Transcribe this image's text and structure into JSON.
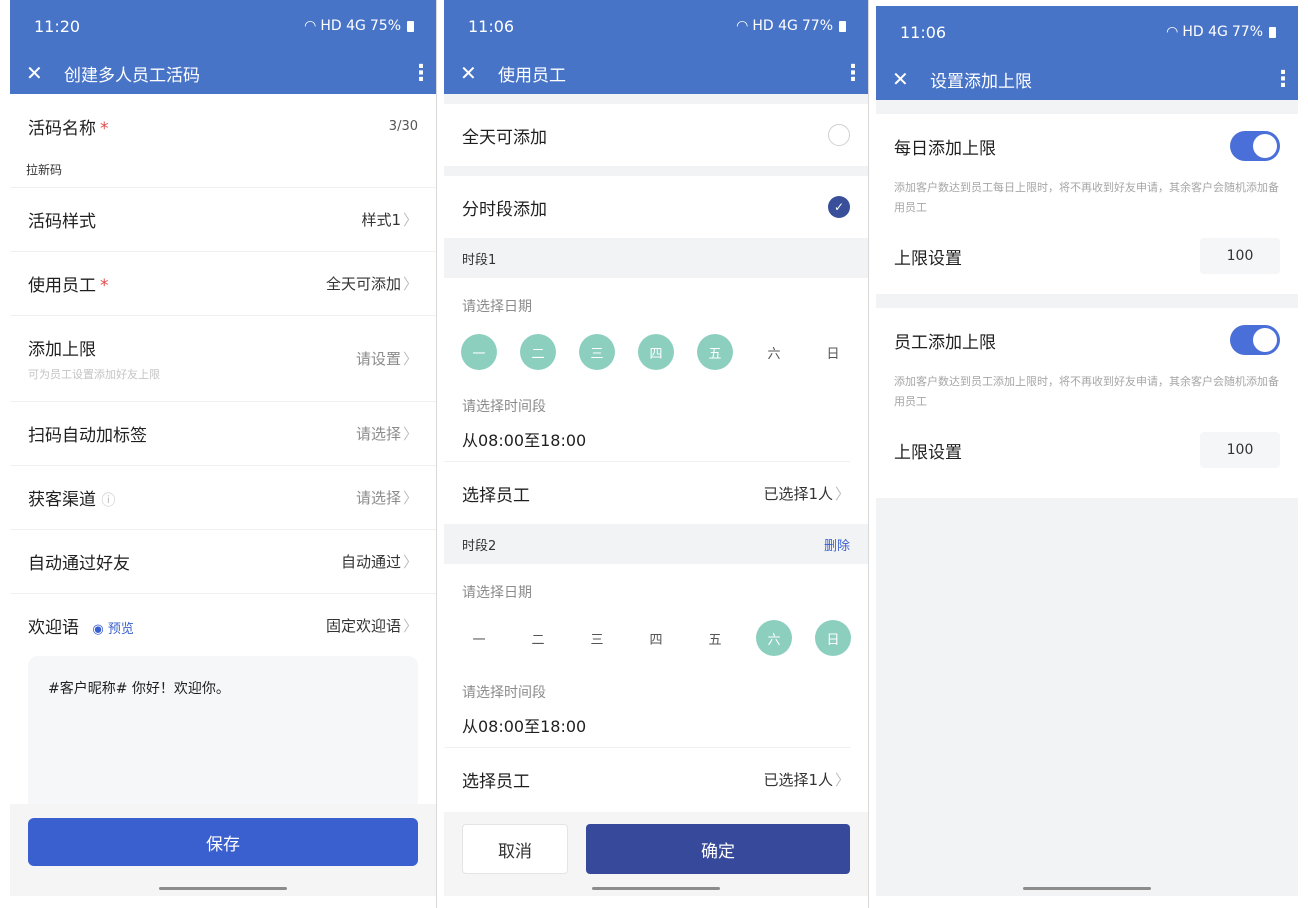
{
  "screen1": {
    "status": {
      "time": "11:20",
      "icons": "HD 4G",
      "battery": "75%"
    },
    "appbar": {
      "close": "✕",
      "title": "创建多人员工活码",
      "more": "⋮"
    },
    "name_field": {
      "label": "活码名称",
      "required": "*",
      "counter": "3/30",
      "value": "拉新码"
    },
    "style_row": {
      "label": "活码样式",
      "value": "样式1"
    },
    "staff_row": {
      "label": "使用员工",
      "required": "*",
      "value": "全天可添加"
    },
    "limit_row": {
      "label": "添加上限",
      "sub": "可为员工设置添加好友上限",
      "value": "请设置"
    },
    "tag_row": {
      "label": "扫码自动加标签",
      "value": "请选择"
    },
    "channel_row": {
      "label": "获客渠道",
      "value": "请选择"
    },
    "auto_row": {
      "label": "自动通过好友",
      "value": "自动通过"
    },
    "welcome_row": {
      "label": "欢迎语",
      "preview": "预览",
      "value": "固定欢迎语"
    },
    "welcome_text": "#客户昵称# 你好！欢迎你。",
    "save_label": "保存"
  },
  "screen2": {
    "status": {
      "time": "11:06",
      "icons": "HD 4G",
      "battery": "77%"
    },
    "appbar": {
      "close": "✕",
      "title": "使用员工",
      "more": "⋮"
    },
    "allday_label": "全天可添加",
    "timed_label": "分时段添加",
    "period1": {
      "title": "时段1",
      "date_hint": "请选择日期",
      "days": [
        "一",
        "二",
        "三",
        "四",
        "五",
        "六",
        "日"
      ],
      "selected": [
        true,
        true,
        true,
        true,
        true,
        false,
        false
      ],
      "time_hint": "请选择时间段",
      "time_value": "从08:00至18:00",
      "staff_label": "选择员工",
      "staff_value": "已选择1人"
    },
    "period2": {
      "title": "时段2",
      "delete": "删除",
      "date_hint": "请选择日期",
      "days": [
        "一",
        "二",
        "三",
        "四",
        "五",
        "六",
        "日"
      ],
      "selected": [
        false,
        false,
        false,
        false,
        false,
        true,
        true
      ],
      "time_hint": "请选择时间段",
      "time_value": "从08:00至18:00",
      "staff_label": "选择员工",
      "staff_value": "已选择1人"
    },
    "cancel_label": "取消",
    "confirm_label": "确定"
  },
  "screen3": {
    "status": {
      "time": "11:06",
      "icons": "HD 4G",
      "battery": "77%"
    },
    "appbar": {
      "close": "✕",
      "title": "设置添加上限",
      "more": "⋮"
    },
    "daily": {
      "label": "每日添加上限",
      "enabled": true,
      "desc": "添加客户数达到员工每日上限时，将不再收到好友申请，其余客户会随机添加备用员工",
      "limit_label": "上限设置",
      "limit_value": "100"
    },
    "staff": {
      "label": "员工添加上限",
      "enabled": true,
      "desc": "添加客户数达到员工添加上限时，将不再收到好友申请，其余客户会随机添加备用员工",
      "limit_label": "上限设置",
      "limit_value": "100"
    }
  },
  "colors": {
    "header": "#4874c8",
    "primary": "#3a5fcf",
    "confirm": "#37499a",
    "day_selected": "#8dcfbf",
    "required": "#e04b4b"
  }
}
